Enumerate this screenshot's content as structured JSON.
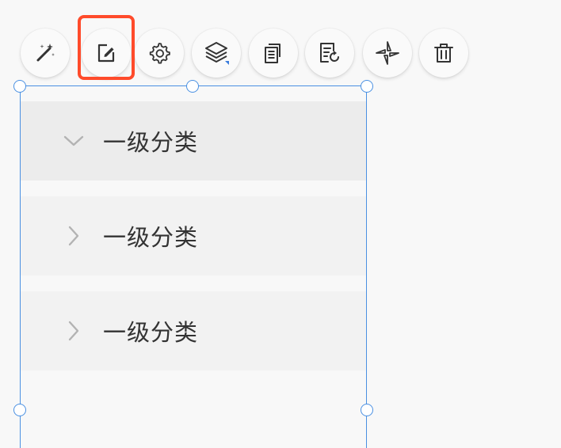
{
  "toolbar": {
    "items": [
      {
        "icon": "magic-wand-icon"
      },
      {
        "icon": "edit-icon",
        "selected": true
      },
      {
        "icon": "settings-gear-icon"
      },
      {
        "icon": "layers-icon"
      },
      {
        "icon": "copy-icon"
      },
      {
        "icon": "replace-icon"
      },
      {
        "icon": "move-arrows-icon"
      },
      {
        "icon": "trash-icon"
      }
    ],
    "highlight_color": "#ff4b2b"
  },
  "selection": {
    "border_color": "#4a90e2"
  },
  "menu": {
    "rows": [
      {
        "label": "一级分类",
        "state": "expanded"
      },
      {
        "label": "一级分类",
        "state": "collapsed"
      },
      {
        "label": "一级分类",
        "state": "collapsed"
      }
    ]
  }
}
